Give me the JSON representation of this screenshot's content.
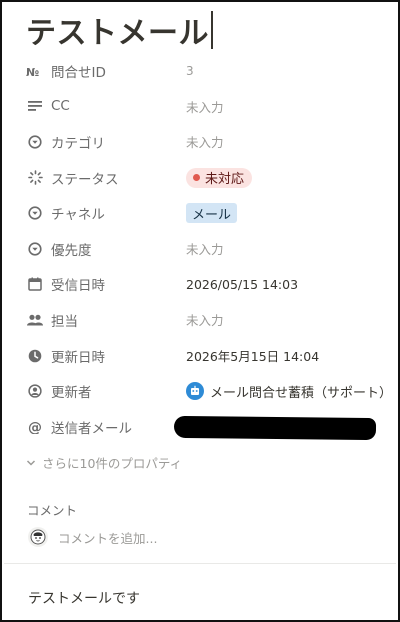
{
  "page": {
    "title": "テストメール"
  },
  "properties": [
    {
      "icon": "number-icon",
      "label": "問合せID",
      "value": "3",
      "kind": "number"
    },
    {
      "icon": "text-lines-icon",
      "label": "CC",
      "value": "未入力",
      "kind": "empty"
    },
    {
      "icon": "select-circle-icon",
      "label": "カテゴリ",
      "value": "未入力",
      "kind": "empty"
    },
    {
      "icon": "status-spinner-icon",
      "label": "ステータス",
      "value": "未対応",
      "kind": "status"
    },
    {
      "icon": "select-circle-icon",
      "label": "チャネル",
      "value": "メール",
      "kind": "tag"
    },
    {
      "icon": "select-circle-icon",
      "label": "優先度",
      "value": "未入力",
      "kind": "empty"
    },
    {
      "icon": "calendar-icon",
      "label": "受信日時",
      "value": "2026/05/15 14:03",
      "kind": "text"
    },
    {
      "icon": "people-icon",
      "label": "担当",
      "value": "未入力",
      "kind": "empty"
    },
    {
      "icon": "clock-icon",
      "label": "更新日時",
      "value": "2026年5月15日 14:04",
      "kind": "text"
    },
    {
      "icon": "person-circle-icon",
      "label": "更新者",
      "value": "メール問合せ蓄積（サポート）",
      "kind": "user"
    },
    {
      "icon": "at-sign-icon",
      "label": "送信者メール",
      "value": "",
      "kind": "redacted"
    }
  ],
  "more_properties": "さらに10件のプロパティ",
  "comments": {
    "header": "コメント",
    "placeholder": "コメントを追加..."
  },
  "body_text": "テストメールです",
  "colors": {
    "status_dot": "#e0594e",
    "status_bg": "#fbe3e1",
    "tag_bg": "#d3e5f5"
  }
}
